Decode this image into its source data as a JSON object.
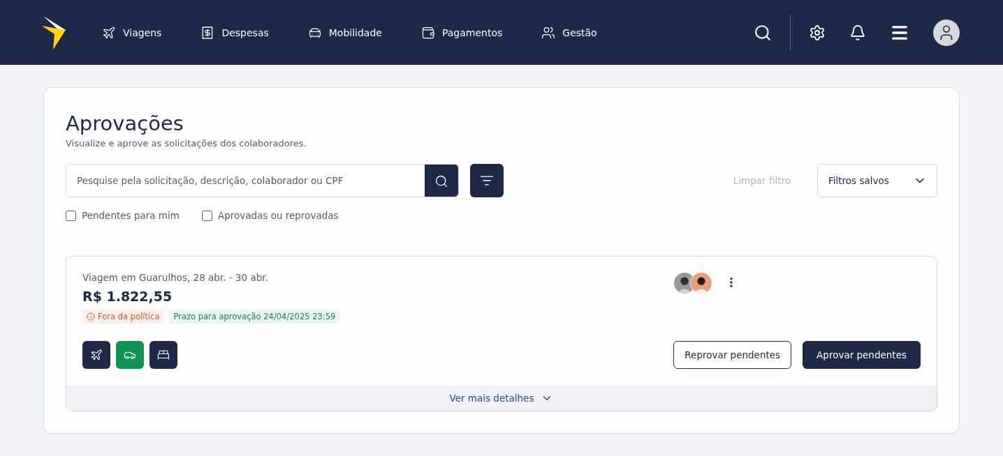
{
  "nav": [
    {
      "label": "Viagens",
      "kind": "plane"
    },
    {
      "label": "Despesas",
      "kind": "receipt"
    },
    {
      "label": "Mobilidade",
      "kind": "car"
    },
    {
      "label": "Pagamentos",
      "kind": "wallet"
    },
    {
      "label": "Gestão",
      "kind": "users"
    }
  ],
  "page": {
    "title": "Aprovações",
    "subtitle": "Visualize e aprove as solicitações dos colaboradores."
  },
  "search": {
    "placeholder": "Pesquise pela solicitação, descrição, colaborador ou CPF"
  },
  "clear_filter": {
    "label": "Limpar filtro",
    "disabled": true
  },
  "saved_filters": {
    "label": "Filtros salvos"
  },
  "checkboxes": [
    {
      "label": "Pendentes para mim",
      "checked": false
    },
    {
      "label": "Aprovadas ou reprovadas",
      "checked": false
    }
  ],
  "requests": [
    {
      "title": "Viagem em Guarulhos, 28 abr. - 30 abr.",
      "amount": "R$ 1.822,55",
      "tags": [
        {
          "label": "Fora da política",
          "kind": "warning"
        },
        {
          "label": "Prazo para aprovação 24/04/2025 23:59",
          "kind": "success"
        }
      ],
      "avatars": [
        {
          "kind": "picture"
        },
        {
          "kind": "picture"
        }
      ],
      "services": [
        {
          "kind": "plane",
          "color": "#1e2847"
        },
        {
          "kind": "car",
          "color": "#0f9455"
        },
        {
          "kind": "bed",
          "color": "#1e2847"
        }
      ],
      "reject_label": "Reprovar pendentes",
      "approve_label": "Aprovar pendentes",
      "details_label": "Ver mais detalhes"
    }
  ]
}
